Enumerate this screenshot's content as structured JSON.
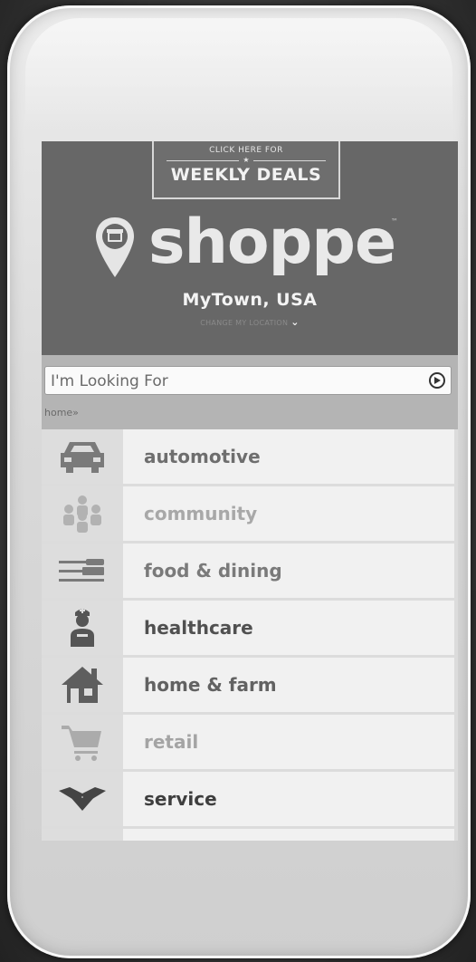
{
  "banner": {
    "small_text": "CLICK HERE FOR",
    "big_text": "WEEKLY DEALS"
  },
  "brand": {
    "logo_text": "shoppe",
    "trademark": "™"
  },
  "location": {
    "name": "MyTown, USA",
    "change_label": "CHANGE MY LOCATION"
  },
  "search": {
    "placeholder": "I'm Looking For"
  },
  "breadcrumb": {
    "text": "home»"
  },
  "categories": [
    {
      "label": "automotive",
      "icon": "car-icon",
      "color": "#6e6e6e",
      "icon_color": "#7a7a7a"
    },
    {
      "label": "community",
      "icon": "people-icon",
      "color": "#a8a8a8",
      "icon_color": "#b2b2b2"
    },
    {
      "label": "food & dining",
      "icon": "fork-knife-icon",
      "color": "#7a7a7a",
      "icon_color": "#7a7a7a"
    },
    {
      "label": "healthcare",
      "icon": "nurse-icon",
      "color": "#505050",
      "icon_color": "#555555"
    },
    {
      "label": "home & farm",
      "icon": "house-icon",
      "color": "#626262",
      "icon_color": "#5e5e5e"
    },
    {
      "label": "retail",
      "icon": "cart-icon",
      "color": "#a4a4a4",
      "icon_color": "#ababab"
    },
    {
      "label": "service",
      "icon": "handshake-icon",
      "color": "#3e3e3e",
      "icon_color": "#444444"
    }
  ],
  "colors": {
    "header_bg": "#676767",
    "search_bg": "#b4b4b4"
  }
}
